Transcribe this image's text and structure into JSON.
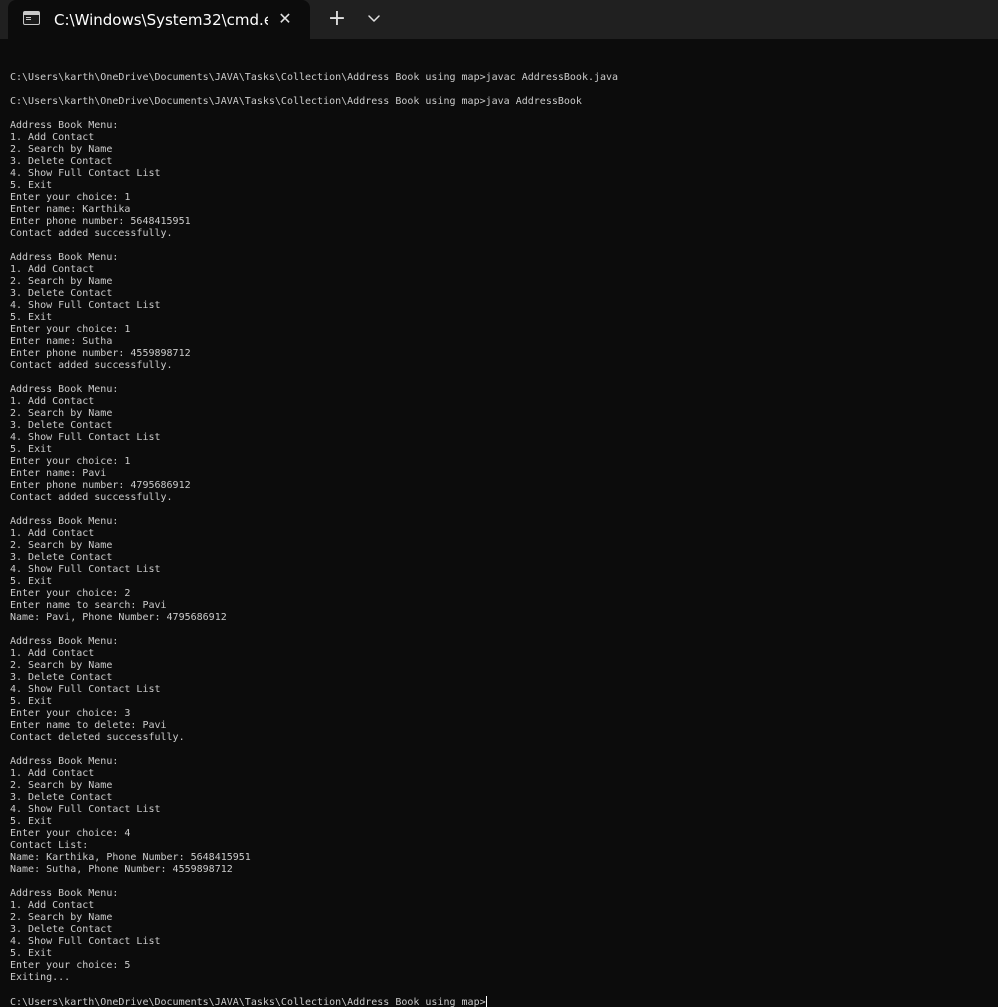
{
  "tab": {
    "title": "C:\\Windows\\System32\\cmd.e",
    "close_glyph": "✕",
    "icon": "console-icon"
  },
  "toolbar": {
    "new_tab_glyph": "+",
    "dropdown_icon": "chevron-down-icon"
  },
  "console": {
    "lines": [
      "",
      "C:\\Users\\karth\\OneDrive\\Documents\\JAVA\\Tasks\\Collection\\Address Book using map>javac AddressBook.java",
      "",
      "C:\\Users\\karth\\OneDrive\\Documents\\JAVA\\Tasks\\Collection\\Address Book using map>java AddressBook",
      "",
      "Address Book Menu:",
      "1. Add Contact",
      "2. Search by Name",
      "3. Delete Contact",
      "4. Show Full Contact List",
      "5. Exit",
      "Enter your choice: 1",
      "Enter name: Karthika",
      "Enter phone number: 5648415951",
      "Contact added successfully.",
      "",
      "Address Book Menu:",
      "1. Add Contact",
      "2. Search by Name",
      "3. Delete Contact",
      "4. Show Full Contact List",
      "5. Exit",
      "Enter your choice: 1",
      "Enter name: Sutha",
      "Enter phone number: 4559898712",
      "Contact added successfully.",
      "",
      "Address Book Menu:",
      "1. Add Contact",
      "2. Search by Name",
      "3. Delete Contact",
      "4. Show Full Contact List",
      "5. Exit",
      "Enter your choice: 1",
      "Enter name: Pavi",
      "Enter phone number: 4795686912",
      "Contact added successfully.",
      "",
      "Address Book Menu:",
      "1. Add Contact",
      "2. Search by Name",
      "3. Delete Contact",
      "4. Show Full Contact List",
      "5. Exit",
      "Enter your choice: 2",
      "Enter name to search: Pavi",
      "Name: Pavi, Phone Number: 4795686912",
      "",
      "Address Book Menu:",
      "1. Add Contact",
      "2. Search by Name",
      "3. Delete Contact",
      "4. Show Full Contact List",
      "5. Exit",
      "Enter your choice: 3",
      "Enter name to delete: Pavi",
      "Contact deleted successfully.",
      "",
      "Address Book Menu:",
      "1. Add Contact",
      "2. Search by Name",
      "3. Delete Contact",
      "4. Show Full Contact List",
      "5. Exit",
      "Enter your choice: 4",
      "Contact List:",
      "Name: Karthika, Phone Number: 5648415951",
      "Name: Sutha, Phone Number: 4559898712",
      "",
      "Address Book Menu:",
      "1. Add Contact",
      "2. Search by Name",
      "3. Delete Contact",
      "4. Show Full Contact List",
      "5. Exit",
      "Enter your choice: 5",
      "Exiting...",
      ""
    ],
    "prompt": "C:\\Users\\karth\\OneDrive\\Documents\\JAVA\\Tasks\\Collection\\Address Book using map>"
  },
  "colors": {
    "background": "#0c0c0c",
    "titlebar": "#202020",
    "text": "#cccccc"
  }
}
